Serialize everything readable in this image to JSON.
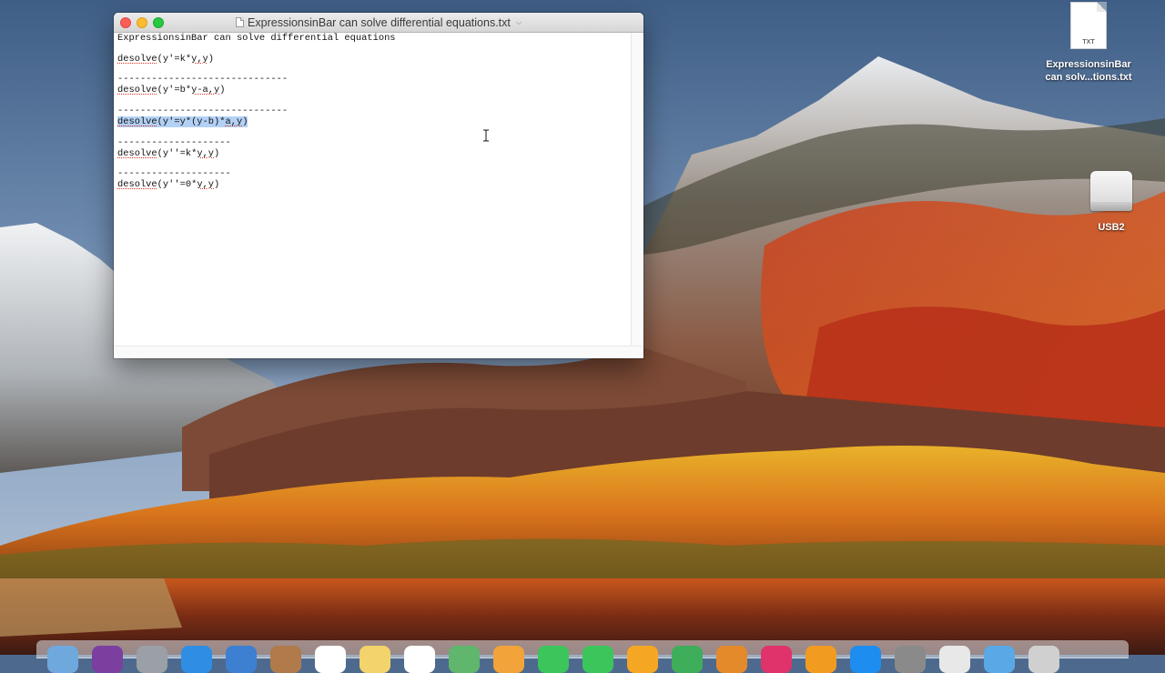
{
  "window": {
    "title": "ExpressionsinBar can solve differential equations.txt",
    "lines": [
      {
        "segments": [
          {
            "text": "ExpressionsinBar can solve differential equations",
            "style": "plain"
          }
        ]
      },
      {
        "segments": [
          {
            "text": "desolve",
            "style": "spell"
          },
          {
            "text": "(y'=k*",
            "style": "plain"
          },
          {
            "text": "y,y",
            "style": "spell"
          },
          {
            "text": ")",
            "style": "plain"
          }
        ]
      },
      {
        "segments": [
          {
            "text": "------------------------------",
            "style": "plain"
          }
        ]
      },
      {
        "segments": [
          {
            "text": "desolve",
            "style": "spell"
          },
          {
            "text": "(y'=b*",
            "style": "plain"
          },
          {
            "text": "y-a,y",
            "style": "spell"
          },
          {
            "text": ")",
            "style": "plain"
          }
        ]
      },
      {
        "segments": [
          {
            "text": "------------------------------",
            "style": "plain"
          }
        ]
      },
      {
        "segments": [
          {
            "text": "desolve",
            "style": "spell-selected"
          },
          {
            "text": "(y'=y*(y-b)*",
            "style": "selected"
          },
          {
            "text": "a,y",
            "style": "spell-selected"
          },
          {
            "text": ")",
            "style": "selected"
          }
        ]
      },
      {
        "segments": [
          {
            "text": "--------------------",
            "style": "plain"
          }
        ]
      },
      {
        "segments": [
          {
            "text": "desolve",
            "style": "spell"
          },
          {
            "text": "(y''=k*",
            "style": "plain"
          },
          {
            "text": "y,y",
            "style": "spell"
          },
          {
            "text": ")",
            "style": "plain"
          }
        ]
      },
      {
        "segments": [
          {
            "text": "--------------------",
            "style": "plain"
          }
        ]
      },
      {
        "segments": [
          {
            "text": "desolve",
            "style": "spell"
          },
          {
            "text": "(y''=0*",
            "style": "plain"
          },
          {
            "text": "y,y",
            "style": "spell"
          },
          {
            "text": ")",
            "style": "plain"
          }
        ]
      }
    ]
  },
  "desktop": {
    "txt_file": {
      "badge": "TXT",
      "label_line1": "ExpressionsinBar",
      "label_line2": "can solv...tions.txt"
    },
    "usb": {
      "label": "USB2"
    }
  },
  "dock": {
    "items": [
      "finder-icon",
      "siri-icon",
      "launchpad-icon",
      "safari-icon",
      "mail-icon",
      "contacts-icon",
      "calendar-icon",
      "notes-icon",
      "reminders-icon",
      "maps-icon",
      "photos-icon",
      "messages-icon",
      "facetime-icon",
      "pages-icon",
      "numbers-icon",
      "keynote-icon",
      "itunes-icon",
      "books-icon",
      "app-store-icon",
      "system-preferences-icon",
      "textedit-icon",
      "downloads-folder-icon",
      "trash-icon"
    ]
  },
  "colors": {
    "selection": "#b3d1f5",
    "spell_underline": "#e0352a",
    "close": "#fc5f57",
    "minimize": "#fdbc2e",
    "zoom": "#28c840"
  }
}
